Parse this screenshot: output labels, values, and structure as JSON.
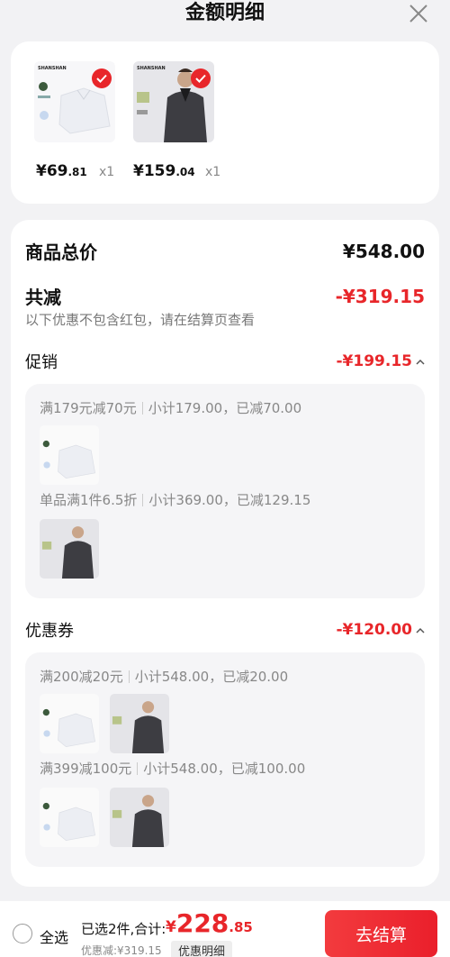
{
  "header": {
    "title": "金额明细"
  },
  "products": [
    {
      "price_int": "¥69",
      "price_dec": ".81",
      "qty": "x1",
      "brand": "SHANSHAN"
    },
    {
      "price_int": "¥159",
      "price_dec": ".04",
      "qty": "x1",
      "brand": "SHANSHAN"
    }
  ],
  "summary": {
    "total_label": "商品总价",
    "total_value": "¥548.00",
    "reduce_label": "共减",
    "reduce_value": "-¥319.15",
    "note": "以下优惠不包含红包，请在结算页查看"
  },
  "promotion": {
    "label": "促销",
    "amount": "-¥199.15",
    "rules": [
      {
        "name": "满179元减70元",
        "detail": "小计179.00，已减70.00"
      },
      {
        "name": "单品满1件6.5折",
        "detail": "小计369.00，已减129.15"
      }
    ]
  },
  "coupon": {
    "label": "优惠券",
    "amount": "-¥120.00",
    "rules": [
      {
        "name": "满200减20元",
        "detail": "小计548.00，已减20.00"
      },
      {
        "name": "满399减100元",
        "detail": "小计548.00，已减100.00"
      }
    ]
  },
  "bottom": {
    "select_all": "全选",
    "selected": "已选2件,合计:",
    "currency": "¥",
    "total_int": "228",
    "total_dec": ".85",
    "discount": "优惠减:¥319.15",
    "discount_detail": "优惠明细",
    "checkout": "去结算"
  },
  "colors": {
    "accent": "#e8262a"
  }
}
